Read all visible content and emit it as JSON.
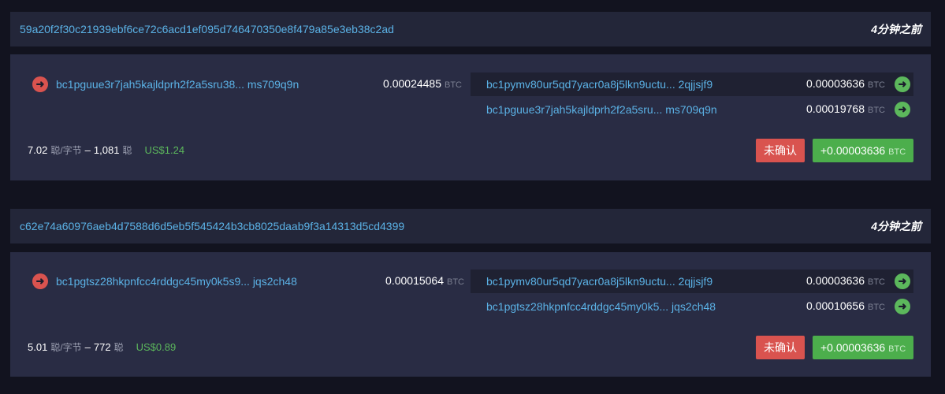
{
  "transactions": [
    {
      "txid": "59a20f2f30c21939ebf6ce72c6acd1ef095d746470350e8f479a85e3eb38c2ad",
      "time": "4分钟之前",
      "input": {
        "address": "bc1pguue3r7jah5kajldprh2f2a5sru38... ms709q9n",
        "amount": "0.00024485",
        "unit": "BTC"
      },
      "outputs": [
        {
          "address": "bc1pymv80ur5qd7yacr0a8j5lkn9uctu... 2qjjsjf9",
          "amount": "0.00003636",
          "unit": "BTC"
        },
        {
          "address": "bc1pguue3r7jah5kajldprh2f2a5sru... ms709q9n",
          "amount": "0.00019768",
          "unit": "BTC"
        }
      ],
      "fee_rate": "7.02",
      "fee_rate_unit": "聪/字节",
      "dash": "–",
      "fee": "1,081",
      "fee_unit": "聪",
      "usd": "US$1.24",
      "status": "未确认",
      "total": "+0.00003636",
      "total_unit": "BTC"
    },
    {
      "txid": "c62e74a60976aeb4d7588d6d5eb5f545424b3cb8025daab9f3a14313d5cd4399",
      "time": "4分钟之前",
      "input": {
        "address": "bc1pgtsz28hkpnfcc4rddgc45my0k5s9... jqs2ch48",
        "amount": "0.00015064",
        "unit": "BTC"
      },
      "outputs": [
        {
          "address": "bc1pymv80ur5qd7yacr0a8j5lkn9uctu... 2qjjsjf9",
          "amount": "0.00003636",
          "unit": "BTC"
        },
        {
          "address": "bc1pgtsz28hkpnfcc4rddgc45my0k5... jqs2ch48",
          "amount": "0.00010656",
          "unit": "BTC"
        }
      ],
      "fee_rate": "5.01",
      "fee_rate_unit": "聪/字节",
      "dash": "–",
      "fee": "772",
      "fee_unit": "聪",
      "usd": "US$0.89",
      "status": "未确认",
      "total": "+0.00003636",
      "total_unit": "BTC"
    }
  ],
  "icons": {
    "input_arrow": "arrow-right-circle-red",
    "output_arrow": "arrow-right-circle-green"
  },
  "colors": {
    "link": "#5bb2e6",
    "unconfirmed": "#d9534f",
    "positive": "#5cb85c",
    "background": "#12131f",
    "panel": "#292c44"
  }
}
